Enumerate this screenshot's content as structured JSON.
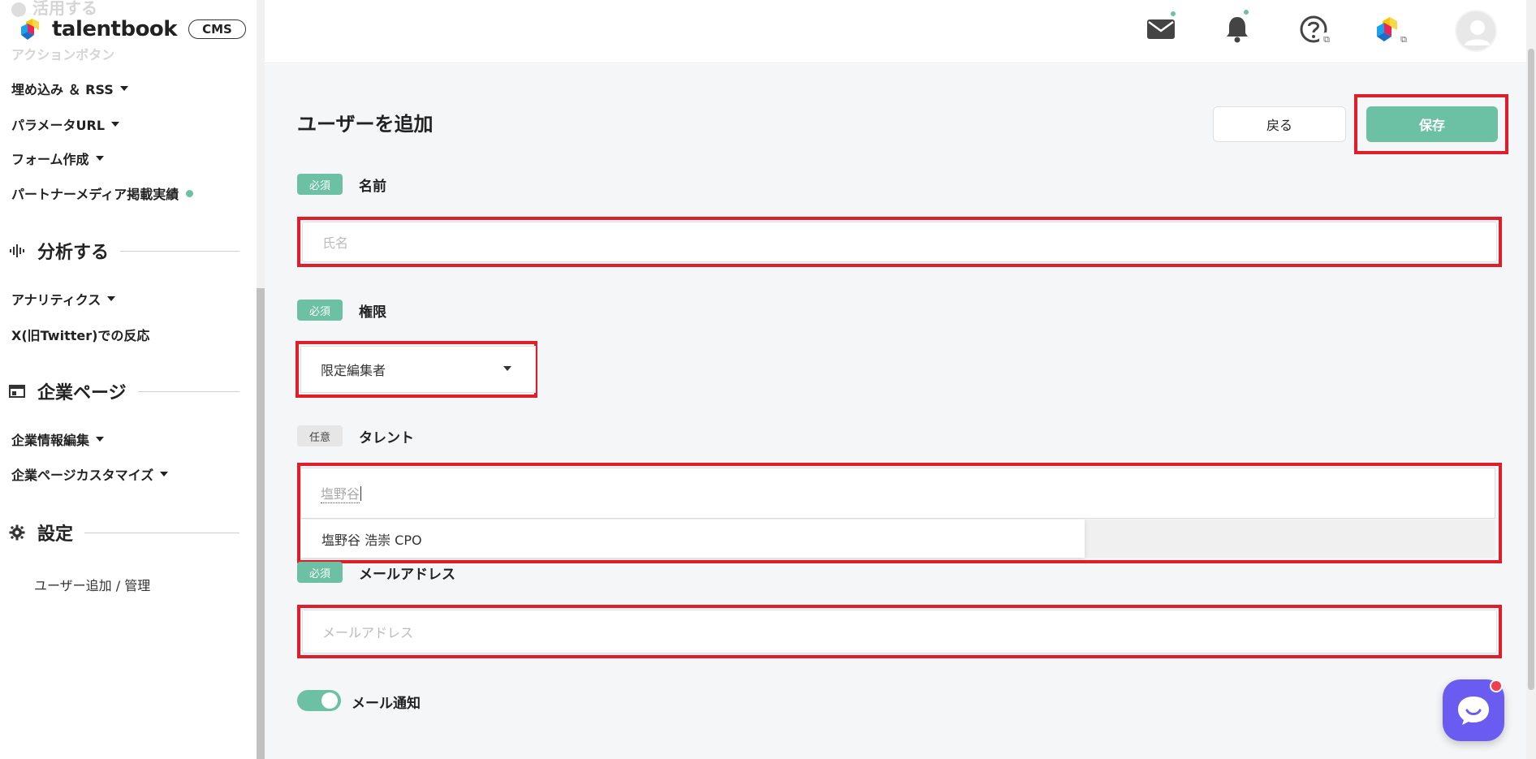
{
  "sidebar": {
    "ghost_top": "活用する",
    "ghost_action": "アクションボタン",
    "logo_text": "talentbook",
    "cms_label": "CMS",
    "items_top": [
      {
        "label": "埋め込み ＆ RSS"
      },
      {
        "label": "パラメータURL"
      },
      {
        "label": "フォーム作成"
      },
      {
        "label": "パートナーメディア掲載実績"
      }
    ],
    "section_analyze": "分析する",
    "items_analyze": [
      {
        "label": "アナリティクス"
      },
      {
        "label": "X(旧Twitter)での反応"
      }
    ],
    "section_company": "企業ページ",
    "items_company": [
      {
        "label": "企業情報編集"
      },
      {
        "label": "企業ページカスタマイズ"
      }
    ],
    "section_settings": "設定",
    "settings_sub": "ユーザー追加 / 管理"
  },
  "header": {
    "icons": [
      "mail-icon",
      "bell-icon",
      "help-icon",
      "talentbook-app-icon",
      "avatar-icon"
    ]
  },
  "form": {
    "title": "ユーザーを追加",
    "back_label": "戻る",
    "save_label": "保存",
    "name": {
      "badge": "必須",
      "label": "名前",
      "placeholder": "氏名"
    },
    "role": {
      "badge": "必須",
      "label": "権限",
      "value": "限定編集者"
    },
    "talent": {
      "badge": "任意",
      "label": "タレント",
      "value": "塩野谷",
      "suggestion": "塩野谷 浩崇 CPO"
    },
    "email": {
      "badge": "必須",
      "label": "メールアドレス",
      "placeholder": "メールアドレス"
    },
    "notify": {
      "label": "メール通知",
      "on": true
    }
  },
  "colors": {
    "accent": "#6cc1a4",
    "highlight": "#e01e2b",
    "chat": "#6a5cf0"
  }
}
